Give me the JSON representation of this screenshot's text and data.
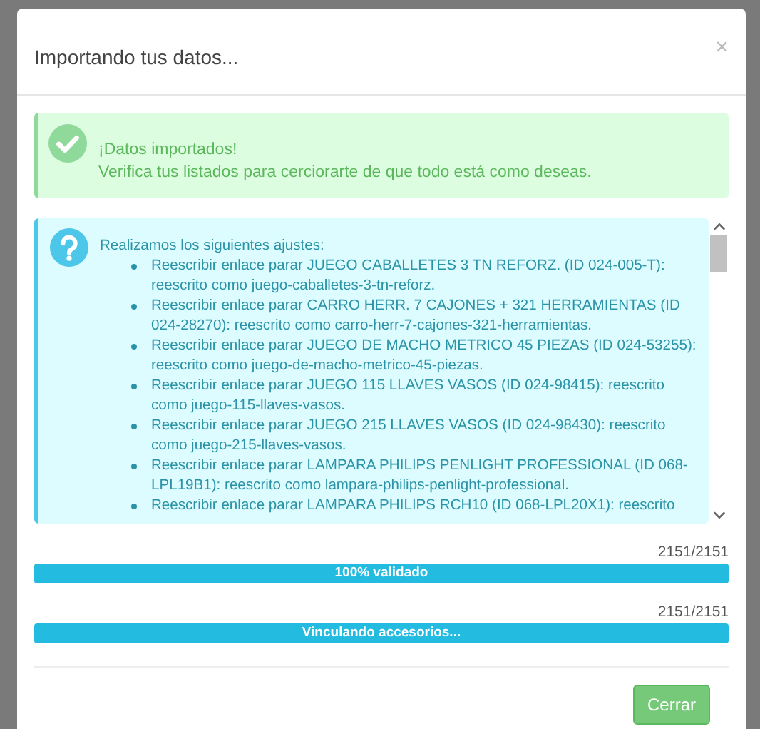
{
  "modal": {
    "title": "Importando tus datos...",
    "close": "×"
  },
  "success_alert": {
    "title": "¡Datos importados!",
    "message": "Verifica tus listados para cerciorarte de que todo está como deseas."
  },
  "info_box": {
    "intro": "Realizamos los siguientes ajustes:",
    "items": [
      "Reescribir enlace parar JUEGO CABALLETES 3 TN REFORZ. (ID 024-005-T): reescrito como juego-caballetes-3-tn-reforz.",
      "Reescribir enlace parar CARRO HERR. 7 CAJONES + 321 HERRAMIENTAS (ID 024-28270): reescrito como carro-herr-7-cajones-321-herramientas.",
      "Reescribir enlace parar JUEGO DE MACHO METRICO 45 PIEZAS (ID 024-53255): reescrito como juego-de-macho-metrico-45-piezas.",
      "Reescribir enlace parar JUEGO 115 LLAVES VASOS (ID 024-98415): reescrito como juego-115-llaves-vasos.",
      "Reescribir enlace parar JUEGO 215 LLAVES VASOS (ID 024-98430): reescrito como juego-215-llaves-vasos.",
      "Reescribir enlace parar LAMPARA PHILIPS PENLIGHT PROFESSIONAL (ID 068-LPL19B1): reescrito como lampara-philips-penlight-professional.",
      "Reescribir enlace parar LAMPARA PHILIPS RCH10 (ID 068-LPL20X1): reescrito"
    ]
  },
  "progress": [
    {
      "count": "2151/2151",
      "label": "100% validado",
      "level": 1
    },
    {
      "count": "2151/2151",
      "label": "Vinculando accesorios...",
      "level": 1
    }
  ],
  "buttons": [
    "Cerrar"
  ]
}
